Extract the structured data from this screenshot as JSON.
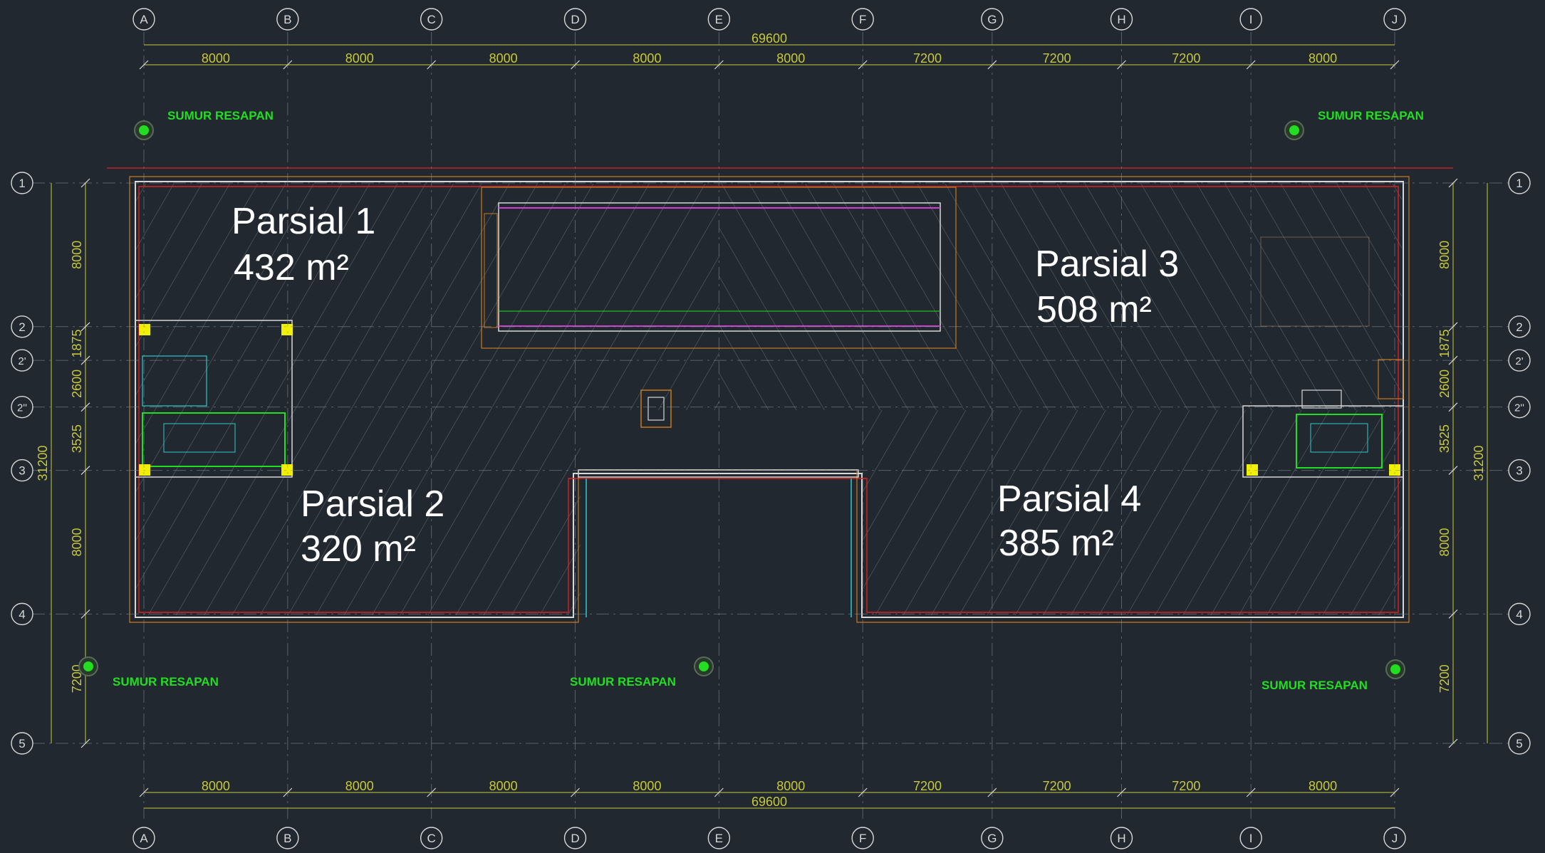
{
  "grid": {
    "columns": [
      "A",
      "B",
      "C",
      "D",
      "E",
      "F",
      "G",
      "H",
      "I",
      "J"
    ],
    "column_spacings": [
      "8000",
      "8000",
      "8000",
      "8000",
      "8000",
      "7200",
      "7200",
      "7200",
      "8000"
    ],
    "total_width": "69600",
    "rows": [
      "1",
      "2",
      "2'",
      "2''",
      "3",
      "4",
      "5"
    ],
    "row_spacings": [
      "8000",
      "1875",
      "2600",
      "3525",
      "8000",
      "7200"
    ],
    "total_height": "31200"
  },
  "zones": [
    {
      "name": "Parsial 1",
      "area": "432 m²"
    },
    {
      "name": "Parsial 2",
      "area": "320 m²"
    },
    {
      "name": "Parsial 3",
      "area": "508 m²"
    },
    {
      "name": "Parsial 4",
      "area": "385 m²"
    }
  ],
  "labels": {
    "sumur": "SUMUR RESAPAN"
  },
  "colors": {
    "background": "#212830",
    "dimension": "#c8c83a",
    "green": "#22dd22",
    "outline": "#d8d8d8",
    "orange": "#c8781e",
    "red": "#dd2020",
    "magenta": "#d040d0",
    "cyan": "#30c8c8",
    "yellow": "#f0f000"
  }
}
